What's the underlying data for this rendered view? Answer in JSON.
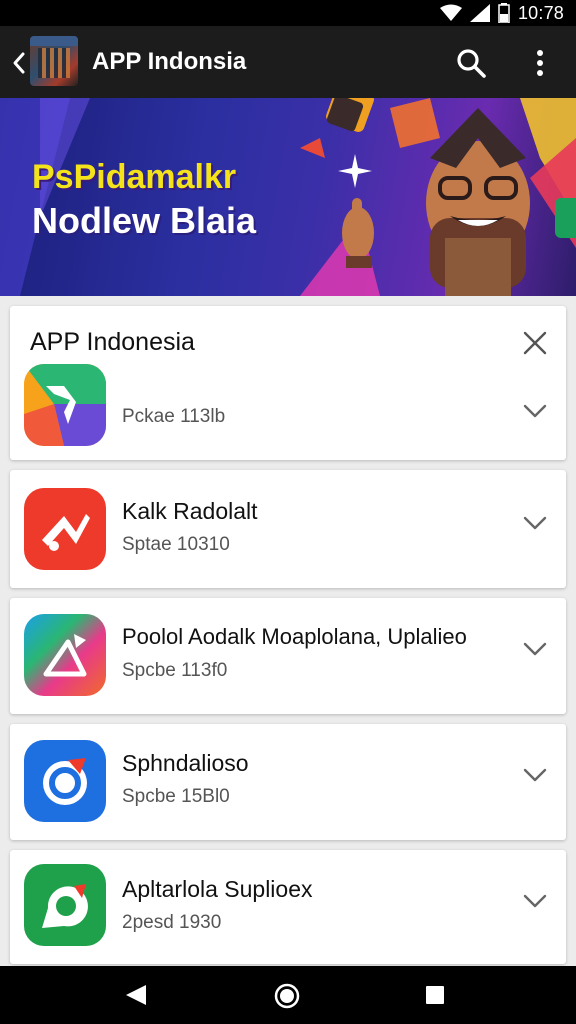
{
  "status_bar": {
    "time": "10:78"
  },
  "app_bar": {
    "title": "APP Indonsia"
  },
  "banner": {
    "line1": "PsPidamalkr",
    "line2": "Nodlew Blaia"
  },
  "card": {
    "title": "APP Indonesia"
  },
  "apps": [
    {
      "name": "",
      "size": "Pckae 113lb",
      "icon": "multicolor-arrow-icon"
    },
    {
      "name": "Kalk Radolalt",
      "size": "Sptae 10310",
      "icon": "red-scissor-icon"
    },
    {
      "name": "Poolol Aodalk Moaplolana, Uplalieo",
      "size": "Spcbe 113f0",
      "icon": "gradient-triangle-icon"
    },
    {
      "name": "Sphndalioso",
      "size": "Spcbe 15Bl0",
      "icon": "blue-circle-icon"
    },
    {
      "name": "Apltarlola Suplioex",
      "size": "2pesd 1930",
      "icon": "green-c-icon"
    }
  ],
  "colors": {
    "banner_yellow": "#f4e21a",
    "app_bar": "#1c1c1c",
    "status_bar": "#000000"
  }
}
